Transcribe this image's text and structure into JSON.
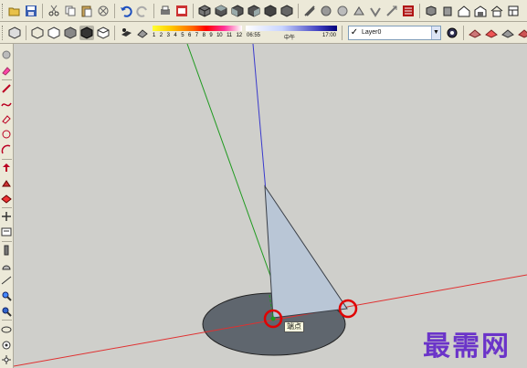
{
  "toolbar_top": {
    "icons": [
      "open-folder-icon",
      "save-icon",
      "cut-icon",
      "copy-icon",
      "paste-icon",
      "erase-icon",
      "undo-icon",
      "redo-icon",
      "print-icon",
      "model-info-icon",
      "iso-view-icon",
      "top-view-icon",
      "front-view-icon",
      "right-view-icon",
      "back-view-icon",
      "left-view-icon",
      "xray-icon",
      "sandbox-icon",
      "smoove-icon",
      "stamp-icon",
      "drape-icon",
      "add-detail-icon",
      "flip-edge-icon",
      "component-icon",
      "house-icon",
      "warehouse-icon",
      "share-model-icon",
      "get-models-icon"
    ]
  },
  "toolbar_second": {
    "icons": [
      "style-xray-icon",
      "style-wireframe-icon",
      "style-hidden-line-icon",
      "style-shaded-icon",
      "style-textured-icon",
      "style-monochrome-icon",
      "shadows-icon",
      "fog-icon"
    ],
    "shadow_months": [
      "1",
      "2",
      "3",
      "4",
      "5",
      "6",
      "7",
      "8",
      "9",
      "10",
      "11",
      "12"
    ],
    "shadow_time_start": "06:55",
    "shadow_time_mid": "中午",
    "shadow_time_end": "17:00",
    "layer_name": "Layer0",
    "layer_check": "✓",
    "layer_dropdown_arrow": "▼",
    "extra_icons": [
      "layer-manager-icon",
      "sandbox-from-contours-icon",
      "sandbox-from-scratch-icon",
      "eye-walk-icon",
      "position-camera-icon",
      "look-around-icon"
    ]
  },
  "left_tools": [
    "select-icon",
    "eraser-icon",
    "line-icon",
    "freehand-icon",
    "rectangle-icon",
    "circle-icon",
    "arc-icon",
    "push-pull-icon",
    "follow-me-icon",
    "offset-icon",
    "move-icon",
    "rotate-icon",
    "scale-icon",
    "tape-measure-icon",
    "dimension-icon",
    "protractor-icon",
    "text-icon",
    "axes-icon",
    "3d-text-icon",
    "paint-bucket-icon",
    "orbit-icon",
    "pan-icon",
    "zoom-icon",
    "zoom-window-icon",
    "zoom-extents-icon",
    "walk-icon",
    "look-around-icon",
    "position-camera-icon",
    "section-plane-icon"
  ],
  "viewport": {
    "tooltip": "端点",
    "watermark": "最需网",
    "colors": {
      "background": "#cfcfcb",
      "red_axis": "#e03030",
      "green_axis": "#1f9a1f",
      "blue_axis": "#3a3acc",
      "disc_fill": "#5f666e",
      "triangle_fill": "#b9c6d6",
      "highlight_circle": "#e00000",
      "watermark": "#6b34c9"
    }
  }
}
